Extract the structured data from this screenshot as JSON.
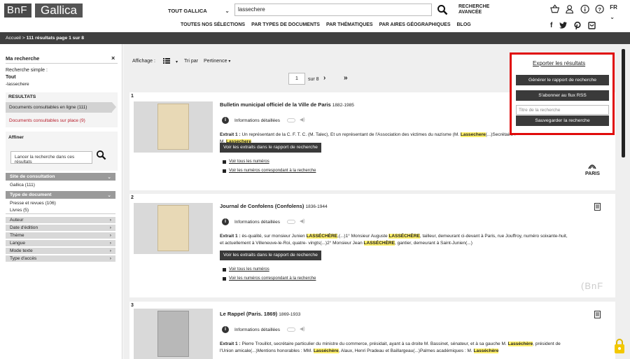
{
  "header": {
    "logo_bnf": "BnF",
    "logo_gallica": "Gallica",
    "scope": "TOUT GALLICA",
    "search_value": "lassechere",
    "advanced_line1": "RECHERCHE",
    "advanced_line2": "AVANCÉE",
    "lang": "FR"
  },
  "nav": {
    "items": [
      "TOUTES NOS SÉLECTIONS",
      "PAR TYPES DE DOCUMENTS",
      "PAR THÉMATIQUES",
      "PAR AIRES GÉOGRAPHIQUES",
      "BLOG"
    ],
    "socials": [
      "f",
      "t",
      "p",
      "i"
    ]
  },
  "breadcrumb": {
    "home": "Accueil >",
    "summary": "111 résultats page 1 sur 8"
  },
  "left": {
    "title": "Ma recherche",
    "close": "×",
    "simple": "Recherche simple :",
    "tout": "Tout",
    "term": "-lassechere",
    "results_title": "RESULTATS",
    "online": "Documents consultables en ligne (111)",
    "onsite": "Documents consultables sur place (9)",
    "affiner": "Affiner",
    "affiner_placeholder": "Lancer la recherche dans ces résultats",
    "facet_site": "Site de consultation",
    "facet_site_value": "Gallica (111)",
    "facet_type": "Type de document",
    "facet_type_v1": "Presse et revues (106)",
    "facet_type_v2": "Livres (5)",
    "collapsed": [
      "Auteur",
      "Date d'édition",
      "Thème",
      "Langue",
      "Mode texte",
      "Type d'accès"
    ]
  },
  "toolbar": {
    "affichage": "Affichage :",
    "tri": "Tri par",
    "pertinence": "Pertinence",
    "page": "1",
    "sur": "sur 8",
    "next": "›",
    "last": "»"
  },
  "export": {
    "title": "Exporter les résultats",
    "report": "Générer le rapport de recherche",
    "rss": "S'abonner au flux RSS",
    "placeholder": "Titre de la recherche",
    "save": "Sauvegarder la recherche"
  },
  "common": {
    "info": "Informations détaillées",
    "extract_btn": "Voir les extraits dans le rapport de recherche",
    "all_issues": "Voir tous les numéros",
    "matching_issues": "Voir les numéros correspondant à la recherche"
  },
  "results": [
    {
      "num": "1",
      "title": "Bulletin municipal officiel de la Ville de Paris",
      "dates": "1882-1985",
      "extract_label": "Extrait 1 :",
      "extract_pre": "Un représentant de la C. F. T. C. (M. Talec), Et un représentant de l'Association des victimes du nazisme (M. ",
      "extract_hl": "Lassechere",
      "extract_post": "(...)Secrétaire : M.",
      "extract_hl2": "Lassechere"
    },
    {
      "num": "2",
      "title": "Journal de Confolens (Confolens)",
      "dates": "1836-1944",
      "extract_label": "Extrait 1 :",
      "seg1": "ès-qualité, sur monsieur Junien ",
      "hl1": "LASSÉCHÈRE",
      "seg2": ",(...)1° Monsieur Auguste ",
      "hl2": "LASSÉCHÈRE",
      "seg3": ", tailleur, demeurant ci-devant à Paris, rue Jouffroy, numéro soixante-huit, et actuellement à Villeneuve-le-Roi, quatre- vingts(...)2° Monsieur Jean ",
      "hl3": "LASSÉCHÈRE",
      "seg4": ", gantier, demeurant à Saint-Junien(...)"
    },
    {
      "num": "3",
      "title": "Le Rappel (Paris. 1869)",
      "dates": "1869-1933",
      "extract_label": "Extrait 1 :",
      "seg1": "Pierre Trouillot, secrétaire particulier du ministre du commerce, présidait, ayant à sa droite M. Bassinet, sénateur, et à sa gauche M. ",
      "hl1": "Lasséchère",
      "seg2": ", président de l'Union amicale(...)Mentions honorables : MM. ",
      "hl2": "Lasséchère",
      "seg3": ", Alaux, Henri Pradeau et Baillargeau(...)Palmes académiques : M. ",
      "hl3": "Lasséchère",
      "seg4": ""
    }
  ],
  "watermark": {
    "paris": "PARIS",
    "bnf": "(BnF"
  }
}
